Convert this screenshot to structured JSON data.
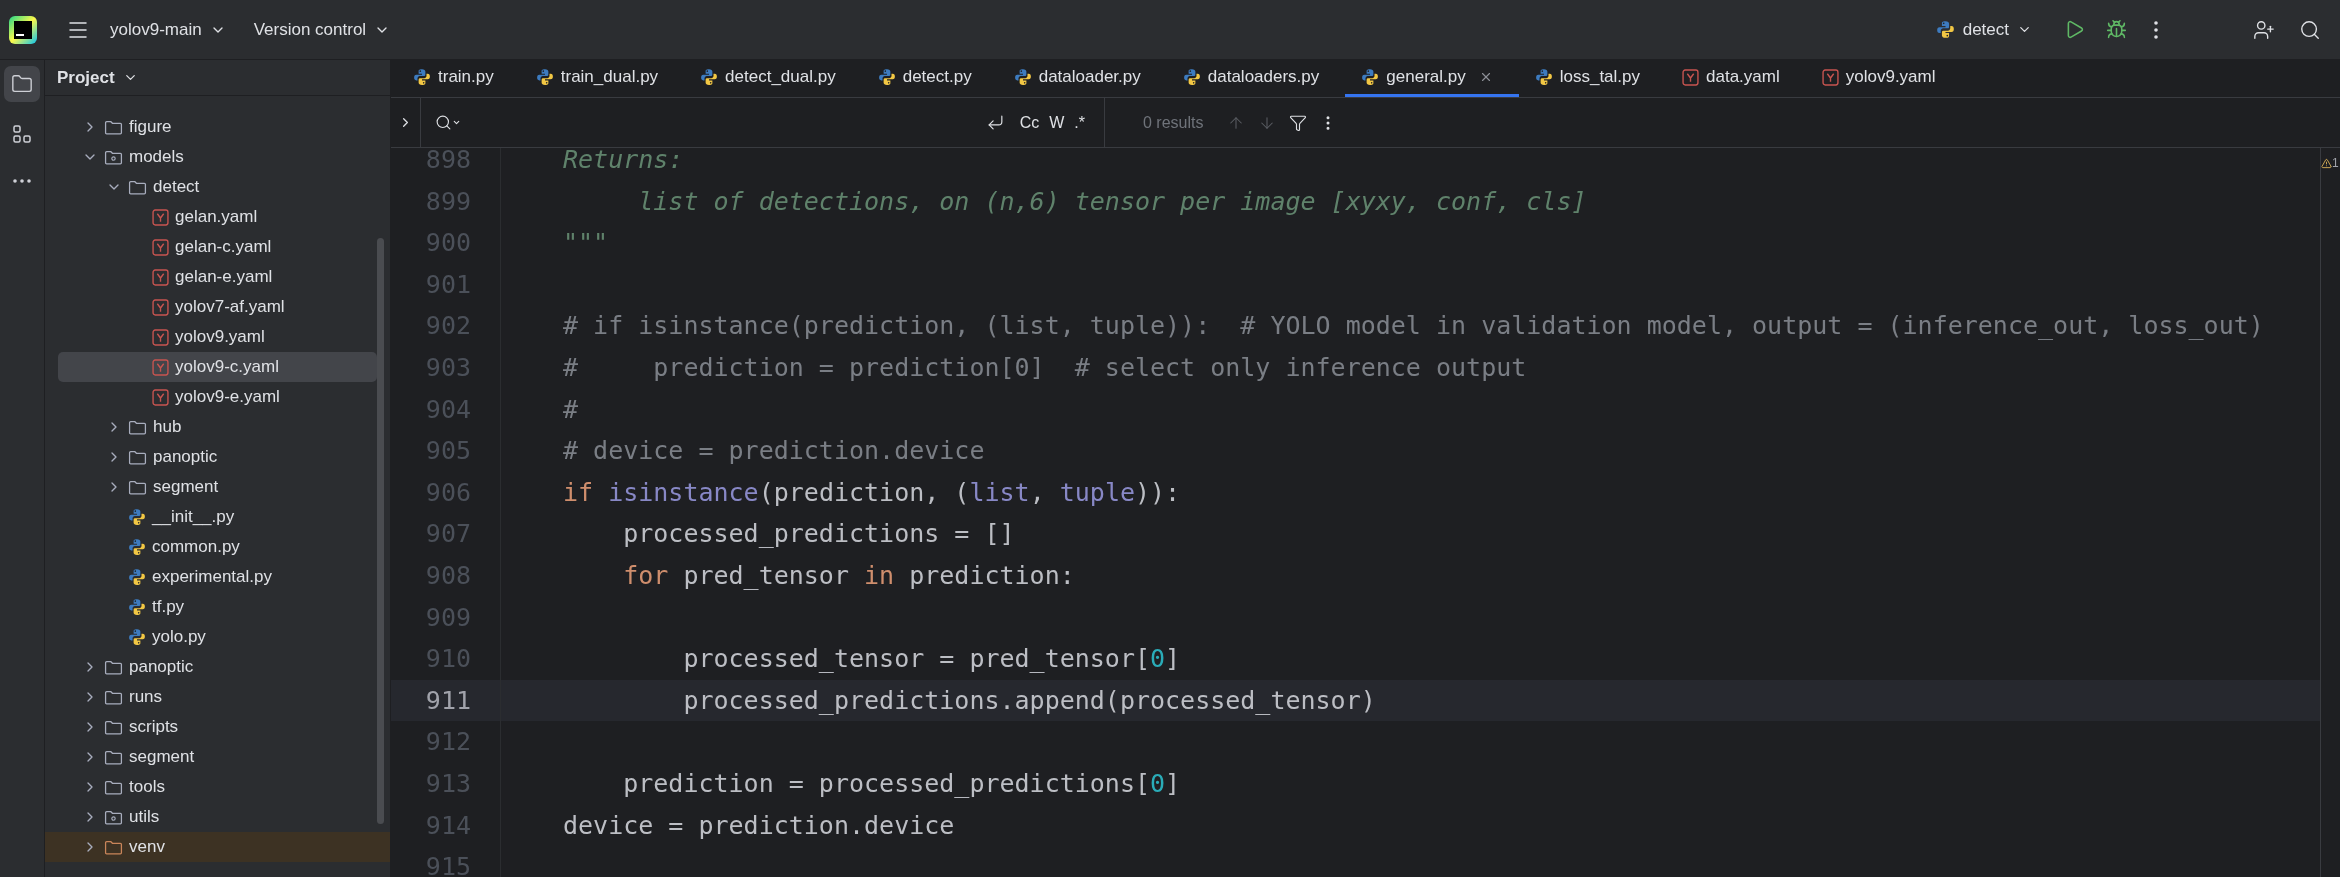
{
  "toolbar": {
    "project": "yolov9-main",
    "vcs": "Version control",
    "run_config": "detect"
  },
  "tool_windows": [
    {
      "kind": "project",
      "selected": true
    },
    {
      "kind": "structure",
      "selected": false
    }
  ],
  "project_panel": {
    "title": "Project",
    "tree": [
      {
        "name": "figure",
        "kind": "folder",
        "expanded": false,
        "selected": false,
        "excluded": false
      },
      {
        "name": "models",
        "kind": "package",
        "expanded": true,
        "selected": false,
        "excluded": false,
        "children": [
          {
            "name": "detect",
            "kind": "folder",
            "expanded": true,
            "selected": false,
            "excluded": false,
            "children": [
              {
                "name": "gelan.yaml",
                "kind": "yaml",
                "selected": false,
                "excluded": false
              },
              {
                "name": "gelan-c.yaml",
                "kind": "yaml",
                "selected": false,
                "excluded": false
              },
              {
                "name": "gelan-e.yaml",
                "kind": "yaml",
                "selected": false,
                "excluded": false
              },
              {
                "name": "yolov7-af.yaml",
                "kind": "yaml",
                "selected": false,
                "excluded": false
              },
              {
                "name": "yolov9.yaml",
                "kind": "yaml",
                "selected": false,
                "excluded": false
              },
              {
                "name": "yolov9-c.yaml",
                "kind": "yaml",
                "selected": true,
                "excluded": false
              },
              {
                "name": "yolov9-e.yaml",
                "kind": "yaml",
                "selected": false,
                "excluded": false
              }
            ]
          },
          {
            "name": "hub",
            "kind": "folder",
            "expanded": false,
            "selected": false,
            "excluded": false
          },
          {
            "name": "panoptic",
            "kind": "folder",
            "expanded": false,
            "selected": false,
            "excluded": false
          },
          {
            "name": "segment",
            "kind": "folder",
            "expanded": false,
            "selected": false,
            "excluded": false
          },
          {
            "name": "__init__.py",
            "kind": "python",
            "selected": false,
            "excluded": false
          },
          {
            "name": "common.py",
            "kind": "python",
            "selected": false,
            "excluded": false
          },
          {
            "name": "experimental.py",
            "kind": "python",
            "selected": false,
            "excluded": false
          },
          {
            "name": "tf.py",
            "kind": "python",
            "selected": false,
            "excluded": false
          },
          {
            "name": "yolo.py",
            "kind": "python",
            "selected": false,
            "excluded": false
          }
        ]
      },
      {
        "name": "panoptic",
        "kind": "folder",
        "expanded": false,
        "selected": false,
        "excluded": false
      },
      {
        "name": "runs",
        "kind": "folder",
        "expanded": false,
        "selected": false,
        "excluded": false
      },
      {
        "name": "scripts",
        "kind": "folder",
        "expanded": false,
        "selected": false,
        "excluded": false
      },
      {
        "name": "segment",
        "kind": "folder",
        "expanded": false,
        "selected": false,
        "excluded": false
      },
      {
        "name": "tools",
        "kind": "folder",
        "expanded": false,
        "selected": false,
        "excluded": false
      },
      {
        "name": "utils",
        "kind": "package",
        "expanded": false,
        "selected": false,
        "excluded": false
      },
      {
        "name": "venv",
        "kind": "folder",
        "expanded": false,
        "selected": false,
        "excluded": true
      }
    ]
  },
  "tabs": [
    {
      "label": "train.py",
      "kind": "python",
      "selected": false
    },
    {
      "label": "train_dual.py",
      "kind": "python",
      "selected": false
    },
    {
      "label": "detect_dual.py",
      "kind": "python",
      "selected": false
    },
    {
      "label": "detect.py",
      "kind": "python",
      "selected": false
    },
    {
      "label": "dataloader.py",
      "kind": "python",
      "selected": false
    },
    {
      "label": "dataloaders.py",
      "kind": "python",
      "selected": false
    },
    {
      "label": "general.py",
      "kind": "python",
      "selected": true
    },
    {
      "label": "loss_tal.py",
      "kind": "python",
      "selected": false
    },
    {
      "label": "data.yaml",
      "kind": "yaml",
      "selected": false
    },
    {
      "label": "yolov9.yaml",
      "kind": "yaml",
      "selected": false
    }
  ],
  "find_bar": {
    "toggles": [
      {
        "label": "Cc",
        "selected": false
      },
      {
        "label": "W",
        "selected": false
      },
      {
        "label": ".*",
        "selected": false
      }
    ],
    "results": "0 results"
  },
  "editor": {
    "problems": "1",
    "lines": [
      {
        "number": "898",
        "current": false,
        "tokens": [
          {
            "kind": "docstring",
            "text": "Returns:"
          }
        ]
      },
      {
        "number": "899",
        "current": false,
        "tokens": [
          {
            "kind": "docstring",
            "text": "     list of detections, on (n,6) tensor per image [xyxy, conf, cls]"
          }
        ]
      },
      {
        "number": "900",
        "current": false,
        "tokens": [
          {
            "kind": "docstring",
            "text": "\"\"\""
          }
        ]
      },
      {
        "number": "901",
        "current": false
      },
      {
        "number": "902",
        "current": false,
        "tokens": [
          {
            "kind": "comment",
            "text": "# if isinstance(prediction, (list, tuple)):  # YOLO model in validation model, output = (inference_out, loss_out)"
          }
        ]
      },
      {
        "number": "903",
        "current": false,
        "tokens": [
          {
            "kind": "comment",
            "text": "#     prediction = prediction[0]  # select only inference output"
          }
        ]
      },
      {
        "number": "904",
        "current": false,
        "tokens": [
          {
            "kind": "comment",
            "text": "#"
          }
        ]
      },
      {
        "number": "905",
        "current": false,
        "tokens": [
          {
            "kind": "comment",
            "text": "# device = prediction.device"
          }
        ]
      },
      {
        "number": "906",
        "current": false,
        "tokens": [
          {
            "kind": "keyword",
            "text": "if"
          },
          {
            "kind": "builtin",
            "text": " isinstance"
          },
          {
            "kind": "plain",
            "text": "(prediction, ("
          },
          {
            "kind": "builtin",
            "text": "list"
          },
          {
            "kind": "plain",
            "text": ", "
          },
          {
            "kind": "builtin",
            "text": "tuple"
          },
          {
            "kind": "plain",
            "text": ")):"
          }
        ]
      },
      {
        "number": "907",
        "current": false,
        "tokens": [
          {
            "kind": "plain",
            "text": "    processed_predictions = []"
          }
        ]
      },
      {
        "number": "908",
        "current": false,
        "tokens": [
          {
            "kind": "keyword",
            "text": "    for"
          },
          {
            "kind": "plain",
            "text": " pred_tensor "
          },
          {
            "kind": "keyword",
            "text": "in"
          },
          {
            "kind": "plain",
            "text": " prediction:"
          }
        ]
      },
      {
        "number": "909",
        "current": false
      },
      {
        "number": "910",
        "current": false,
        "tokens": [
          {
            "kind": "plain",
            "text": "        processed_tensor = pred_tensor["
          },
          {
            "kind": "number",
            "text": "0"
          },
          {
            "kind": "plain",
            "text": "]"
          }
        ]
      },
      {
        "number": "911",
        "current": true,
        "tokens": [
          {
            "kind": "plain",
            "text": "        processed_predictions.append(processed_tensor)"
          }
        ]
      },
      {
        "number": "912",
        "current": false
      },
      {
        "number": "913",
        "current": false,
        "tokens": [
          {
            "kind": "plain",
            "text": "    prediction = processed_predictions["
          },
          {
            "kind": "number",
            "text": "0"
          },
          {
            "kind": "plain",
            "text": "]"
          }
        ]
      },
      {
        "number": "914",
        "current": false,
        "tokens": [
          {
            "kind": "plain",
            "text": "device = prediction.device"
          }
        ]
      },
      {
        "number": "915",
        "current": false
      }
    ]
  }
}
